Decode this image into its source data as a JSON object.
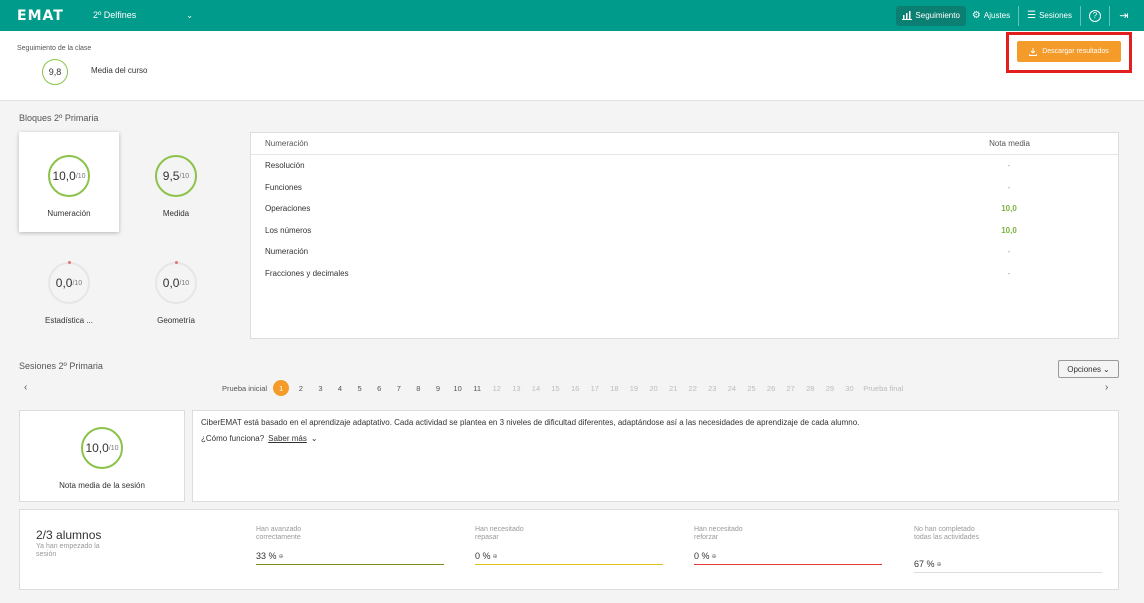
{
  "header": {
    "logo": "EMAT",
    "class_name": "2º Delfines",
    "nav": [
      {
        "label": "Seguimiento",
        "icon": "bar-chart-icon",
        "active": true
      },
      {
        "label": "Ajustes",
        "icon": "gear-icon",
        "active": false
      },
      {
        "label": "Sesiones",
        "icon": "list-icon",
        "active": false
      }
    ],
    "help_icon": "?",
    "logout_icon": "⇥"
  },
  "summary": {
    "label": "Seguimiento de la clase",
    "score": "9,8",
    "score_label": "Media del curso",
    "download_label": "Descargar resultados"
  },
  "blocks": {
    "title": "Bloques 2º Primaria",
    "cards": [
      {
        "score": "10,0",
        "out_of": "/10",
        "name": "Numeración"
      },
      {
        "score": "9,5",
        "out_of": "/10",
        "name": "Medida"
      },
      {
        "score": "0,0",
        "out_of": "/10",
        "name": "Estadística ..."
      },
      {
        "score": "0,0",
        "out_of": "/10",
        "name": "Geometría"
      }
    ],
    "table": {
      "col_name": "Numeración",
      "col_avg": "Nota media",
      "rows": [
        {
          "name": "Resolución",
          "value": "-"
        },
        {
          "name": "Funciones",
          "value": "-"
        },
        {
          "name": "Operaciones",
          "value": "10,0"
        },
        {
          "name": "Los números",
          "value": "10,0"
        },
        {
          "name": "Numeración",
          "value": "-"
        },
        {
          "name": "Fracciones y decimales",
          "value": "-"
        }
      ]
    }
  },
  "sessions": {
    "title": "Sesiones 2º Primaria",
    "options_label": "Opciones",
    "pager": {
      "first": "Prueba inicial",
      "last": "Prueba final",
      "current": "1",
      "enabled": [
        "2",
        "3",
        "4",
        "5",
        "6",
        "7",
        "8",
        "9",
        "10",
        "11"
      ],
      "disabled": [
        "12",
        "13",
        "14",
        "15",
        "16",
        "17",
        "18",
        "19",
        "20",
        "21",
        "22",
        "23",
        "24",
        "25",
        "26",
        "27",
        "28",
        "29",
        "30"
      ]
    },
    "session_score": "10,0",
    "session_out_of": "/10",
    "session_score_label": "Nota media de la sesión",
    "info_text": "CiberEMAT está basado en el aprendizaje adaptativo. Cada actividad se plantea en 3 niveles de dificultad diferentes, adaptándose así a las necesidades de aprendizaje de cada alumno.",
    "how_label": "¿Cómo funciona?",
    "more_label": "Saber más",
    "stats": {
      "count": "2/3 alumnos",
      "count_sub": "Ya han empezado la sesión",
      "items": [
        {
          "label": "Han avanzado correctamente",
          "value": "33 %",
          "color": "#7a8c1c"
        },
        {
          "label": "Han necesitado repasar",
          "value": "0 %",
          "color": "#e0c21b"
        },
        {
          "label": "Han necesitado reforzar",
          "value": "0 %",
          "color": "#e53935"
        },
        {
          "label": "No han completado todas las actividades",
          "value": "67 %",
          "color": "#dddddd"
        }
      ]
    }
  }
}
